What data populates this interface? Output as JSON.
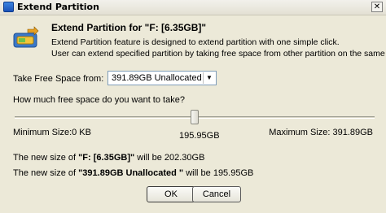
{
  "window": {
    "title": "Extend Partition",
    "close_glyph": "✕"
  },
  "header": {
    "heading": "Extend Partition for \"F: [6.35GB]\"",
    "description_line1": "Extend Partition feature is designed to extend partition with one simple click.",
    "description_line2": "User can extend specified partition by taking free space from other partition on the same disk."
  },
  "source": {
    "label": "Take Free Space from:",
    "selected": "391.89GB Unallocated",
    "arrow_glyph": "▼"
  },
  "amount": {
    "question": "How much free space do you want to take?",
    "min_label": "Minimum Size:0 KB",
    "current_label": "195.95GB",
    "max_label": "Maximum Size: 391.89GB",
    "min_gb": 0,
    "max_gb": 391.89,
    "current_gb": 195.95
  },
  "results": {
    "line1_prefix": "The new size of ",
    "line1_name": "\"F: [6.35GB]\"",
    "line1_suffix": " will be 202.30GB",
    "line2_prefix": "The new size of ",
    "line2_name": "\"391.89GB Unallocated \"",
    "line2_suffix": " will be 195.95GB"
  },
  "buttons": {
    "ok": "OK",
    "cancel": "Cancel"
  },
  "icons": {
    "title_icon": "partition-app-icon",
    "app_icon": "extend-partition-icon"
  }
}
